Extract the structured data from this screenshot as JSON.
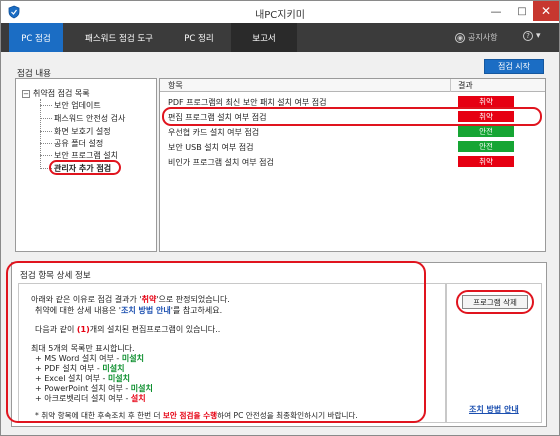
{
  "app": {
    "title": "내PC지키미",
    "window_controls": {
      "minimize": "—",
      "maximize": "□",
      "close": "✕"
    }
  },
  "tabs": [
    {
      "label": "PC 점검",
      "active": true
    },
    {
      "label": "패스워드 점검 도구",
      "active": false
    },
    {
      "label": "PC 정리",
      "active": false
    },
    {
      "label": "보고서",
      "active": false
    }
  ],
  "topbar": {
    "notice_label": "공지사항",
    "help_label": "?",
    "notice_icon": "bell-icon",
    "help_icon": "help-icon"
  },
  "inspection": {
    "section_label": "점검 내용",
    "start_button": "점검 시작"
  },
  "tree": {
    "root_label": "취약점 점검 목록",
    "expander": "−",
    "items": [
      "보안 업데이트",
      "패스워드 안전성 검사",
      "화면 보호기 설정",
      "공유 폴더 설정",
      "보안 프로그램 설치",
      "관리자 추가 점검"
    ]
  },
  "results": {
    "col_item": "항목",
    "col_result": "결과",
    "rows": [
      {
        "label": "PDF 프로그램의 최신 보안 패치 설치 여부 점검",
        "result": "취약",
        "status": "bad"
      },
      {
        "label": "편집 프로그램 설치 여부 점검",
        "result": "취약",
        "status": "bad"
      },
      {
        "label": "우선협 카드 설치 여부 점검",
        "result": "안전",
        "status": "good"
      },
      {
        "label": "보안 USB 설치 여부 점검",
        "result": "안전",
        "status": "good"
      },
      {
        "label": "비인가 프로그램 설치 여부 점검",
        "result": "취약",
        "status": "bad"
      }
    ]
  },
  "detail": {
    "title": "점검 항목 상세 정보",
    "line1_pre": "아래와 같은 이유로 점검 결과가 '",
    "line1_em": "취약",
    "line1_post": "'으로 판정되었습니다.",
    "line2_pre": "취약에 대한 상세 내용은 '",
    "line2_em": "조치 방법 안내",
    "line2_post": "'를 참고하세요.",
    "line3_pre": "다음과 같이 ",
    "line3_em": "(1)",
    "line3_post": "개의 설치된 편집프로그램이 있습니다..",
    "line4": "최대 5개의 목록만 표시합니다.",
    "list": [
      {
        "pre": "+ MS Word 설치 여부 - ",
        "val": "미설치",
        "cls": "green"
      },
      {
        "pre": "+ PDF 설치 여부 - ",
        "val": "미설치",
        "cls": "green"
      },
      {
        "pre": "+ Excel 설치 여부 - ",
        "val": "미설치",
        "cls": "green"
      },
      {
        "pre": "+ PowerPoint 설치 여부 - ",
        "val": "미설치",
        "cls": "green"
      },
      {
        "pre": "+ 아크로벳리더 설치 여부 - ",
        "val": "설치",
        "cls": "red"
      }
    ],
    "footer_pre": "* 취약 항목에 대한 후속조치 후 한번 더 ",
    "footer_em": "보안 점검을 수행",
    "footer_post": "하여 PC 안전성을 최종확인하시기 바랍니다.",
    "delete_button": "프로그램 삭제",
    "action_link": "조치 방법 안내"
  },
  "colors": {
    "accent": "#1b6dc4",
    "vulnerable": "#e60012",
    "safe": "#16a534",
    "annotation": "#e0141e"
  }
}
